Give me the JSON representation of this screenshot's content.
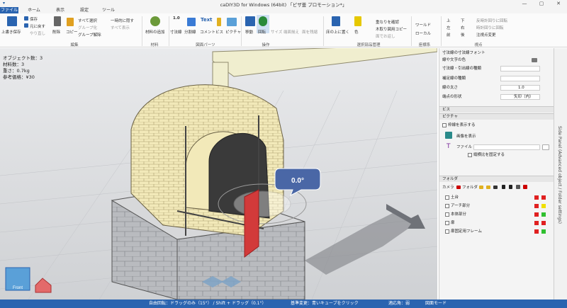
{
  "titlebar": {
    "title": "caDIY3D for Windows (64bit) 「ピザ釜 プロモーション*」",
    "quick_access": "▾",
    "win_min": "—",
    "win_max": "▢",
    "win_close": "✕"
  },
  "tabs": [
    "ファイル",
    "ホーム",
    "表示",
    "設定",
    "ツール"
  ],
  "ribbon": {
    "save_overwrite": "上書き保存",
    "save": "保存",
    "undo": "元に戻す",
    "redo": "やり直し",
    "delete": "削除",
    "copy": "コピー",
    "select_all": "すべて選択",
    "group": "グループ化",
    "ungroup": "グループ解除",
    "hide_temp": "一時的に隠す",
    "show_all": "すべて表示",
    "group_edit": "編集",
    "material_add": "材料の追加",
    "group_material": "材料",
    "dimension": "寸法線",
    "dimension_value": "1.0",
    "divider": "分割線",
    "comment": "コメント",
    "text": "Text",
    "screw": "ビス",
    "picture": "ピクチャ",
    "group_drawing": "図面パーツ",
    "move": "移動",
    "rotate": "回転",
    "size": "サイズ",
    "magnet": "端面揃え",
    "slide": "面を残縮",
    "group_operation": "操作",
    "place_on_floor": "床の上に置く",
    "color": "色",
    "check_overlap": "重なりを確認",
    "copy_lumber": "木取り図用コピー",
    "close_distance": "面でお返し",
    "group_select": "選択部品管理",
    "coord_world": "ワールド",
    "coord_local": "ローカル",
    "group_coord": "座標系",
    "view_top": "上",
    "view_bottom": "下",
    "view_left": "左",
    "view_right": "右",
    "view_front": "前",
    "view_back": "後",
    "view_cw": "反時計回りに回転",
    "view_ccw": "時計回りに回転",
    "view_register": "注視点変更",
    "group_view": "視点"
  },
  "info": {
    "object_count": "オブジェクト数：3",
    "material_count": "材料数：3",
    "weight": "重さ：0.7kg",
    "reference_price": "参考価格：¥30"
  },
  "viewport": {
    "angle_label": "0.0°",
    "front_label": "Front"
  },
  "panel": {
    "section_dimension": "寸法線の寸法線フォント",
    "text_color": "線や文字の色",
    "drawing_style": "寸法線・引出線の種類",
    "aux_style": "補足線の種類",
    "line_width": "線の太さ",
    "line_width_value": "1.0",
    "end_shape": "端点の形状",
    "end_shape_value": "矢印（内）",
    "section_screw": "ビス",
    "section_picture": "ピクチャ",
    "show_frame": "枠線を表示する",
    "show_image": "画像を表示",
    "file": "ファイル",
    "fix_aspect": "縦横比を固定する",
    "section_folder": "フォルダ",
    "camera": "カメラ",
    "folder": "フォルダ",
    "folders": [
      {
        "name": "土台",
        "c1": "#e02020",
        "c2": "#e02020"
      },
      {
        "name": "アーチ部分",
        "c1": "#e02020",
        "c2": "#f0e000"
      },
      {
        "name": "本体部分",
        "c1": "#e02020",
        "c2": "#30c030"
      },
      {
        "name": "扉",
        "c1": "#e02020",
        "c2": "#e02020"
      },
      {
        "name": "扉固定用フレーム",
        "c1": "#e02020",
        "c2": "#30c030"
      }
    ]
  },
  "sidebar": {
    "label": "Side Panel (Advanced object / Folder settings)"
  },
  "status": {
    "left": "自由回転：ドラッグのみ（15°） / Shift + ドラッグ（0.1°）",
    "right": "基準変更：青いキューブをクリック",
    "grid": "適応角：弱",
    "mode": "図面モード"
  }
}
